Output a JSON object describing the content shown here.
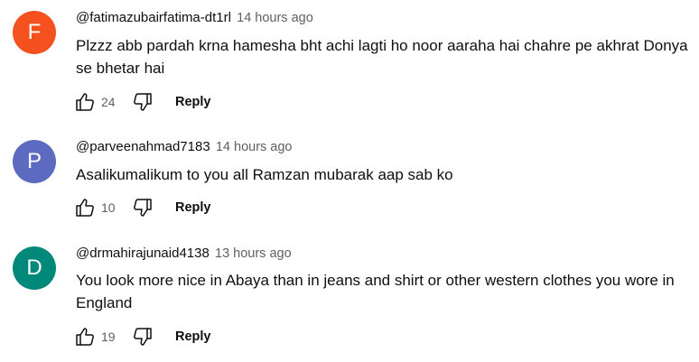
{
  "comments": [
    {
      "avatar_letter": "F",
      "avatar_color": "#f4511e",
      "author": "@fatimazubairfatima-dt1rl",
      "time": "14 hours ago",
      "text": "Plzzz abb pardah krna hamesha bht achi lagti ho noor aaraha hai chahre pe akhrat Donya se bhetar hai",
      "likes": "24",
      "reply_label": "Reply"
    },
    {
      "avatar_letter": "P",
      "avatar_color": "#5c6bc0",
      "author": "@parveenahmad7183",
      "time": "14 hours ago",
      "text": "Asalikumalikum to you all Ramzan mubarak aap sab ko",
      "likes": "10",
      "reply_label": "Reply"
    },
    {
      "avatar_letter": "D",
      "avatar_color": "#00897b",
      "author": "@drmahirajunaid4138",
      "time": "13 hours ago",
      "text": "You look more nice in Abaya than in jeans and shirt or other western clothes you wore in England",
      "likes": "19",
      "reply_label": "Reply"
    }
  ],
  "icons": {
    "like": "thumbs-up-icon",
    "dislike": "thumbs-down-icon"
  }
}
